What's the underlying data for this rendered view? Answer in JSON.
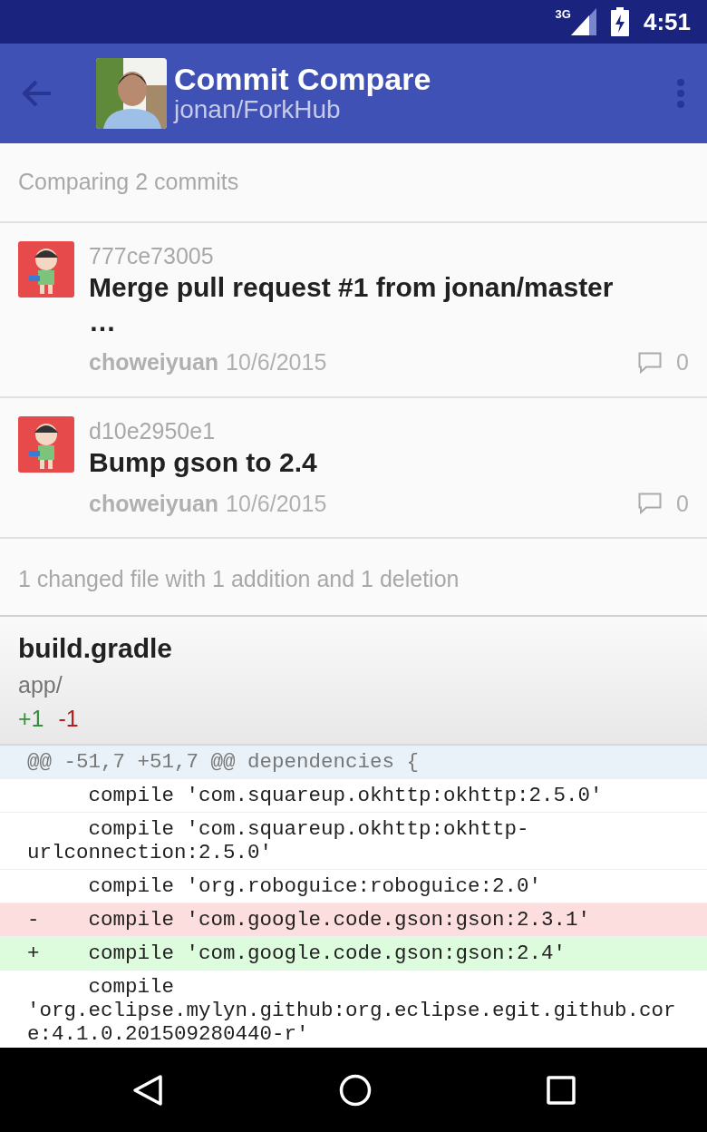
{
  "status_bar": {
    "network": "3G",
    "time": "4:51"
  },
  "app_bar": {
    "title": "Commit Compare",
    "subtitle": "jonan/ForkHub"
  },
  "comparing": "Comparing 2 commits",
  "commits": [
    {
      "sha": "777ce73005",
      "message": "Merge pull request #1 from jonan/master\n…",
      "author": "choweiyuan",
      "date": "10/6/2015",
      "comments": "0"
    },
    {
      "sha": "d10e2950e1",
      "message": "Bump gson to 2.4",
      "author": "choweiyuan",
      "date": "10/6/2015",
      "comments": "0"
    }
  ],
  "summary": "1 changed file with 1 addition and 1 deletion",
  "file": {
    "name": "build.gradle",
    "path": "app/",
    "additions": "+1",
    "deletions": "-1"
  },
  "diff_lines": [
    {
      "kind": "hunk",
      "text": "@@ -51,7 +51,7 @@ dependencies {"
    },
    {
      "kind": "context",
      "text": "     compile 'com.squareup.okhttp:okhttp:2.5.0'"
    },
    {
      "kind": "context",
      "text": "     compile 'com.squareup.okhttp:okhttp-urlconnection:2.5.0'"
    },
    {
      "kind": "context",
      "text": "     compile 'org.roboguice:roboguice:2.0'"
    },
    {
      "kind": "removed",
      "text": "-    compile 'com.google.code.gson:gson:2.3.1'"
    },
    {
      "kind": "added",
      "text": "+    compile 'com.google.code.gson:gson:2.4'"
    },
    {
      "kind": "context",
      "text": "     compile 'org.eclipse.mylyn.github:org.eclipse.egit.github.core:4.1.0.201509280440-r'"
    }
  ]
}
